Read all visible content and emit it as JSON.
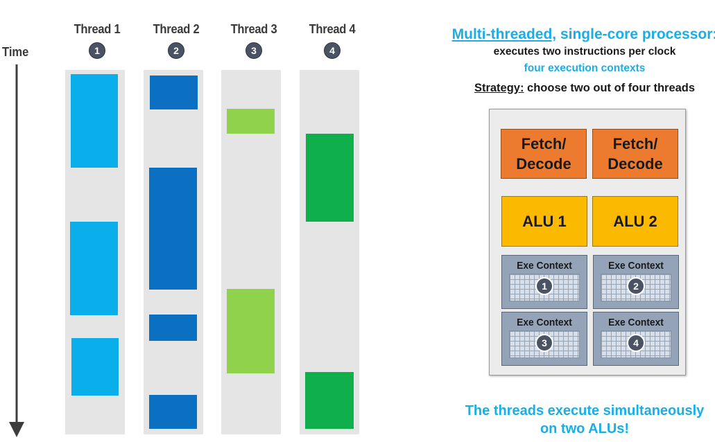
{
  "time_label": "Time",
  "threads": [
    {
      "title": "Thread 1",
      "badge": "1",
      "color": "#0aaeeb"
    },
    {
      "title": "Thread 2",
      "badge": "2",
      "color": "#0b6fc2"
    },
    {
      "title": "Thread 3",
      "badge": "3",
      "color": "#8fd24b"
    },
    {
      "title": "Thread 4",
      "badge": "4",
      "color": "#0fb04b"
    }
  ],
  "panel": {
    "title_underlined": "Multi-threaded,",
    "title_rest": " single-core processor:",
    "line2": "executes two instructions per clock",
    "line3": "four execution contexts",
    "strategy_label": "Strategy:",
    "strategy_text": " choose two out of four threads"
  },
  "chip": {
    "fetch_decode": [
      "Fetch/ Decode",
      "Fetch/ Decode"
    ],
    "alus": [
      "ALU 1",
      "ALU 2"
    ],
    "contexts": [
      {
        "label": "Exe Context",
        "badge": "1"
      },
      {
        "label": "Exe Context",
        "badge": "2"
      },
      {
        "label": "Exe Context",
        "badge": "3"
      },
      {
        "label": "Exe Context",
        "badge": "4"
      }
    ]
  },
  "footer": {
    "line1": "The threads execute simultaneously",
    "line2": "on two ALUs!"
  },
  "colors": {
    "accent": "#1aaee6",
    "fetch": "#ec7b30",
    "alu": "#fbb900",
    "context": "#94a3b8"
  }
}
